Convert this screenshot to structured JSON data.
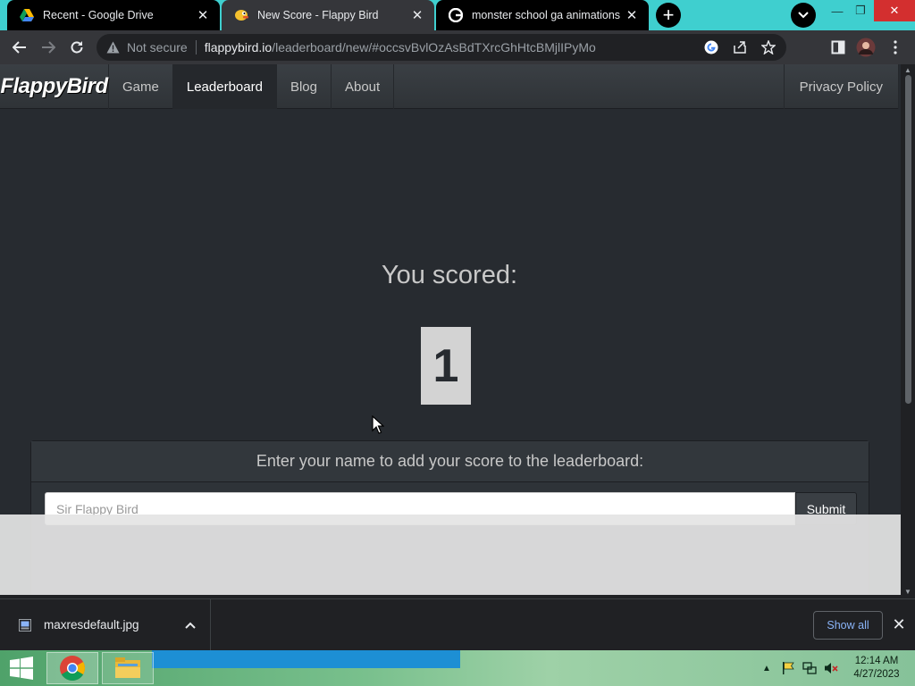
{
  "browser": {
    "tabs": [
      {
        "title": "Recent - Google Drive",
        "icon": "google-drive-icon",
        "active": false
      },
      {
        "title": "New Score - Flappy Bird",
        "icon": "flappy-bird-icon",
        "active": true
      },
      {
        "title": "monster school ga animations - G",
        "icon": "google-icon",
        "active": false
      }
    ],
    "omnibox": {
      "security_label": "Not secure",
      "url_host": "flappybird.io",
      "url_path": "/leaderboard/new/#occsvBvlOzAsBdTXrcGhHtcBMjlIPyMo"
    }
  },
  "site": {
    "brand": "FlappyBird",
    "nav": {
      "game": "Game",
      "leaderboard": "Leaderboard",
      "blog": "Blog",
      "about": "About",
      "privacy": "Privacy Policy"
    },
    "scored_label": "You scored:",
    "score": "1",
    "leaderboard_prompt": "Enter your name to add your score to the leaderboard:",
    "name_placeholder": "Sir Flappy Bird",
    "submit_label": "Submit"
  },
  "downloads": {
    "file_name": "maxresdefault.jpg",
    "show_all_label": "Show all"
  },
  "taskbar": {
    "time": "12:14 AM",
    "date": "4/27/2023"
  },
  "colors": {
    "page_bg": "#272b30",
    "tab_strip": "#3fcfcf",
    "link_blue": "#8ab4f8",
    "close_red": "#d32f2f"
  }
}
